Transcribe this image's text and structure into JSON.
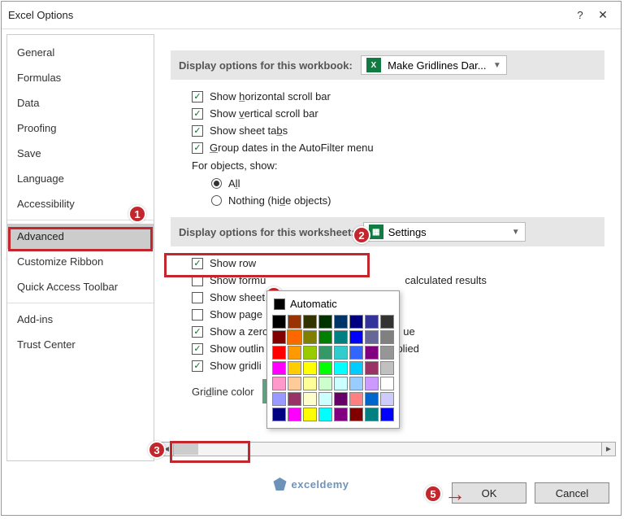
{
  "title": "Excel Options",
  "sidebar": {
    "items": [
      "General",
      "Formulas",
      "Data",
      "Proofing",
      "Save",
      "Language",
      "Accessibility",
      "Advanced",
      "Customize Ribbon",
      "Quick Access Toolbar",
      "Add-ins",
      "Trust Center"
    ],
    "selected": "Advanced"
  },
  "sec_workbook": {
    "label": "Display options for this workbook:",
    "value": "Make Gridlines Dar...",
    "opts": {
      "hscroll": "Show horizontal scroll bar",
      "vscroll": "Show vertical scroll bar",
      "tabs": "Show sheet tabs",
      "group": "Group dates in the AutoFilter menu"
    },
    "for_objects": "For objects, show:",
    "radio_all": "All",
    "radio_nothing": "Nothing (hide objects)"
  },
  "sec_worksheet": {
    "label": "Display options for this worksheet:",
    "value": "Settings",
    "opts": {
      "row": "Show row",
      "formulas": "Show formu",
      "formulas_tail": "calculated results",
      "sheet": "Show sheet",
      "page": "Show page",
      "zero": "Show a zero",
      "zero_tail": "ue",
      "outline": "Show outlin",
      "outline_tail": "pplied",
      "gridlines": "Show gridli"
    },
    "gridline_label": "Gridline color"
  },
  "colorpop": {
    "auto": "Automatic",
    "rows": [
      [
        "#000000",
        "#993300",
        "#333300",
        "#003300",
        "#003366",
        "#000080",
        "#333399",
        "#333333"
      ],
      [
        "#800000",
        "#ff6600",
        "#808000",
        "#008000",
        "#008080",
        "#0000ff",
        "#666699",
        "#808080"
      ],
      [
        "#ff0000",
        "#ff9900",
        "#99cc00",
        "#339966",
        "#33cccc",
        "#3366ff",
        "#800080",
        "#969696"
      ],
      [
        "#ff00ff",
        "#ffcc00",
        "#ffff00",
        "#00ff00",
        "#00ffff",
        "#00ccff",
        "#993366",
        "#c0c0c0"
      ],
      [
        "#ff99cc",
        "#ffcc99",
        "#ffff99",
        "#ccffcc",
        "#ccffff",
        "#99ccff",
        "#cc99ff",
        "#ffffff"
      ],
      [
        "#9999ff",
        "#993366",
        "#ffffcc",
        "#ccffff",
        "#660066",
        "#ff8080",
        "#0066cc",
        "#ccccff"
      ],
      [
        "#000080",
        "#ff00ff",
        "#ffff00",
        "#00ffff",
        "#800080",
        "#800000",
        "#008080",
        "#0000ff"
      ]
    ],
    "selected": [
      1,
      1
    ]
  },
  "footer": {
    "ok": "OK",
    "cancel": "Cancel"
  },
  "badges": [
    "1",
    "2",
    "3",
    "4",
    "5"
  ],
  "watermark": {
    "text": "exceldemy"
  }
}
